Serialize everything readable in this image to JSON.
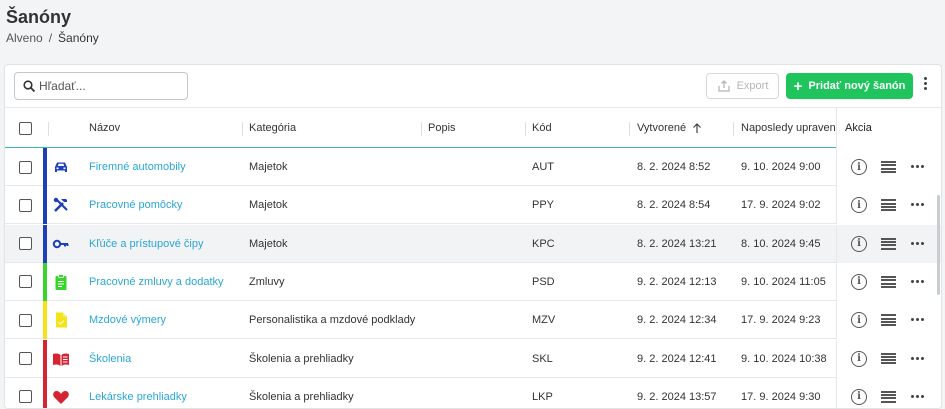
{
  "page": {
    "title": "Šanóny"
  },
  "breadcrumb": {
    "root": "Alveno",
    "separator": "/",
    "current": "Šanóny"
  },
  "toolbar": {
    "search_placeholder": "Hľadať...",
    "export_label": "Export",
    "add_label": "Pridať nový šanón"
  },
  "colors": {
    "accent_green": "#1fc55c",
    "link": "#2aa6d6",
    "header_line": "#3bb6b0"
  },
  "table": {
    "columns": {
      "name": "Názov",
      "category": "Kategória",
      "description": "Popis",
      "code": "Kód",
      "created": "Vytvorené",
      "updated": "Naposledy upravené",
      "actions": "Akcia"
    },
    "sort": {
      "column": "created",
      "direction": "ascending"
    },
    "rows": [
      {
        "name": "Firemné automobily",
        "category": "Majetok",
        "description": "",
        "code": "AUT",
        "created": "8. 2. 2024 8:52",
        "updated": "9. 10. 2024 9:00",
        "color": "#1f3fb8",
        "icon": "car-icon",
        "highlighted": false
      },
      {
        "name": "Pracovné pomôcky",
        "category": "Majetok",
        "description": "",
        "code": "PPY",
        "created": "8. 2. 2024 8:54",
        "updated": "17. 9. 2024 9:02",
        "color": "#1f3fb8",
        "icon": "tools-icon",
        "highlighted": false
      },
      {
        "name": "Kľúče a prístupové čipy",
        "category": "Majetok",
        "description": "",
        "code": "KPC",
        "created": "8. 2. 2024 13:21",
        "updated": "8. 10. 2024 9:45",
        "color": "#1f3fb8",
        "icon": "key-icon",
        "highlighted": true
      },
      {
        "name": "Pracovné zmluvy a dodatky",
        "category": "Zmluvy",
        "description": "",
        "code": "PSD",
        "created": "9. 2. 2024 12:13",
        "updated": "9. 10. 2024 11:05",
        "color": "#39d42c",
        "icon": "clipboard-icon",
        "highlighted": false
      },
      {
        "name": "Mzdové výmery",
        "category": "Personalistika a mzdové podklady",
        "description": "",
        "code": "MZV",
        "created": "9. 2. 2024 12:34",
        "updated": "17. 9. 2024 9:23",
        "color": "#f2e418",
        "icon": "document-icon",
        "highlighted": false
      },
      {
        "name": "Školenia",
        "category": "Školenia a prehliadky",
        "description": "",
        "code": "SKL",
        "created": "9. 2. 2024 12:41",
        "updated": "9. 10. 2024 10:38",
        "color": "#d62433",
        "icon": "book-icon",
        "highlighted": false
      },
      {
        "name": "Lekárske prehliadky",
        "category": "Školenia a prehliadky",
        "description": "",
        "code": "LKP",
        "created": "9. 2. 2024 13:57",
        "updated": "17. 9. 2024 9:30",
        "color": "#d62433",
        "icon": "heart-icon",
        "highlighted": false
      }
    ]
  }
}
